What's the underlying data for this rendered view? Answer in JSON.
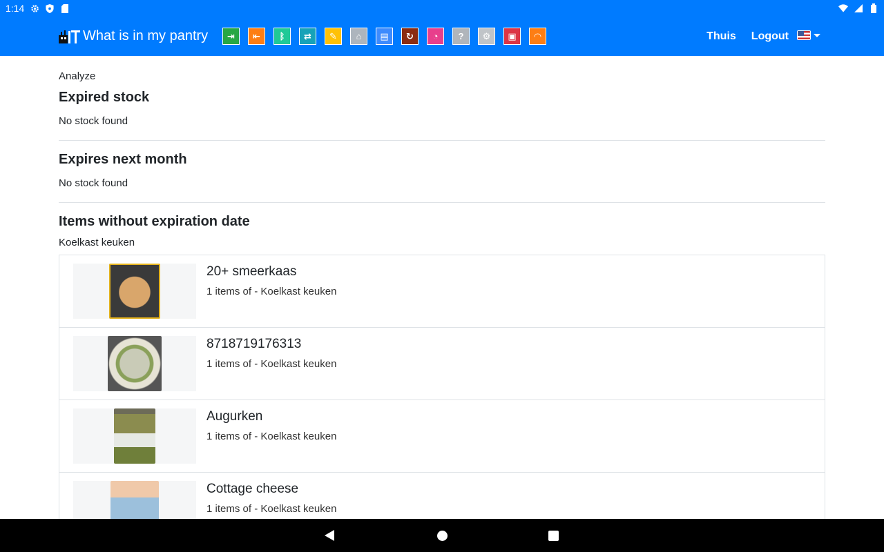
{
  "status_bar": {
    "time": "1:14",
    "icons": [
      "gear-icon",
      "shield-icon",
      "sdcard-icon",
      "wifi-icon",
      "signal-icon",
      "battery-icon"
    ]
  },
  "navbar": {
    "brand": "What is in my pantry",
    "icons": [
      {
        "name": "add-stock-icon",
        "glyph": "⇥",
        "color": "#28a745"
      },
      {
        "name": "remove-stock-icon",
        "glyph": "⇤",
        "color": "#fd7e14"
      },
      {
        "name": "barcode-icon",
        "glyph": "ᛒ",
        "color": "#20c997"
      },
      {
        "name": "move-stock-icon",
        "glyph": "⇄",
        "color": "#17a2b8"
      },
      {
        "name": "products-icon",
        "glyph": "✎",
        "color": "#ffc107"
      },
      {
        "name": "locations-icon",
        "glyph": "⌂",
        "color": "#adb5bd"
      },
      {
        "name": "storage-icon",
        "glyph": "▤",
        "color": "#3d8bfd"
      },
      {
        "name": "refresh-icon",
        "glyph": "↻",
        "color": "#8b2c11"
      },
      {
        "name": "timer-icon",
        "glyph": "◔",
        "color": "#e83e8c"
      },
      {
        "name": "help-icon",
        "glyph": "?",
        "color": "#b0b5bb"
      },
      {
        "name": "settings-icon",
        "glyph": "⚙",
        "color": "#c0c4c8"
      },
      {
        "name": "shop-icon",
        "glyph": "▣",
        "color": "#dc3545"
      },
      {
        "name": "dashboard-icon",
        "glyph": "◠",
        "color": "#fd7e14"
      }
    ],
    "home_label": "Thuis",
    "logout_label": "Logout"
  },
  "page": {
    "breadcrumb": "Analyze",
    "expired_title": "Expired stock",
    "expired_empty": "No stock found",
    "next_month_title": "Expires next month",
    "next_month_empty": "No stock found",
    "no_expiry_title": "Items without expiration date",
    "location_label": "Koelkast keuken"
  },
  "items": [
    {
      "title": "20+ smeerkaas",
      "subtitle": "1 items of - Koelkast keuken"
    },
    {
      "title": "8718719176313",
      "subtitle": "1 items of - Koelkast keuken"
    },
    {
      "title": "Augurken",
      "subtitle": "1 items of - Koelkast keuken"
    },
    {
      "title": "Cottage cheese",
      "subtitle": "1 items of - Koelkast keuken"
    }
  ]
}
